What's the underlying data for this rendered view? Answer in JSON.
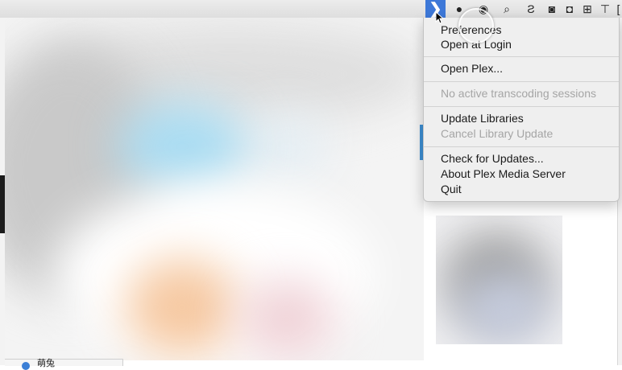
{
  "menubar": {
    "plex_icon_name": "plex-chevron-icon",
    "plex_glyph": "❯",
    "tray_icons": [
      {
        "name": "wechat-icon",
        "glyph": "●"
      },
      {
        "name": "eye-icon",
        "glyph": "◉"
      },
      {
        "name": "search-icon",
        "glyph": "⌕"
      },
      {
        "name": "script-icon",
        "glyph": "Ƨ"
      },
      {
        "name": "cat-icon",
        "glyph": "◙"
      },
      {
        "name": "penguin-icon",
        "glyph": "◘"
      },
      {
        "name": "grid-icon",
        "glyph": "⊞"
      },
      {
        "name": "text-icon",
        "glyph": "⊤"
      },
      {
        "name": "bracket-icon",
        "glyph": "["
      }
    ]
  },
  "menu": {
    "items": [
      {
        "label": "Preferences",
        "enabled": true
      },
      {
        "label": "Open at Login",
        "enabled": true
      },
      {
        "label": "Open Plex...",
        "enabled": true
      },
      {
        "label": "No active transcoding sessions",
        "enabled": false
      },
      {
        "label": "Update Libraries",
        "enabled": true
      },
      {
        "label": "Cancel Library Update",
        "enabled": false
      },
      {
        "label": "Check for Updates...",
        "enabled": true
      },
      {
        "label": "About Plex Media Server",
        "enabled": true
      },
      {
        "label": "Quit",
        "enabled": true
      }
    ]
  },
  "status": {
    "label": "萌兔"
  },
  "colors": {
    "accent": "#3d78d8",
    "menu_background": "#efefef",
    "disabled_text": "#a5a5a5"
  }
}
